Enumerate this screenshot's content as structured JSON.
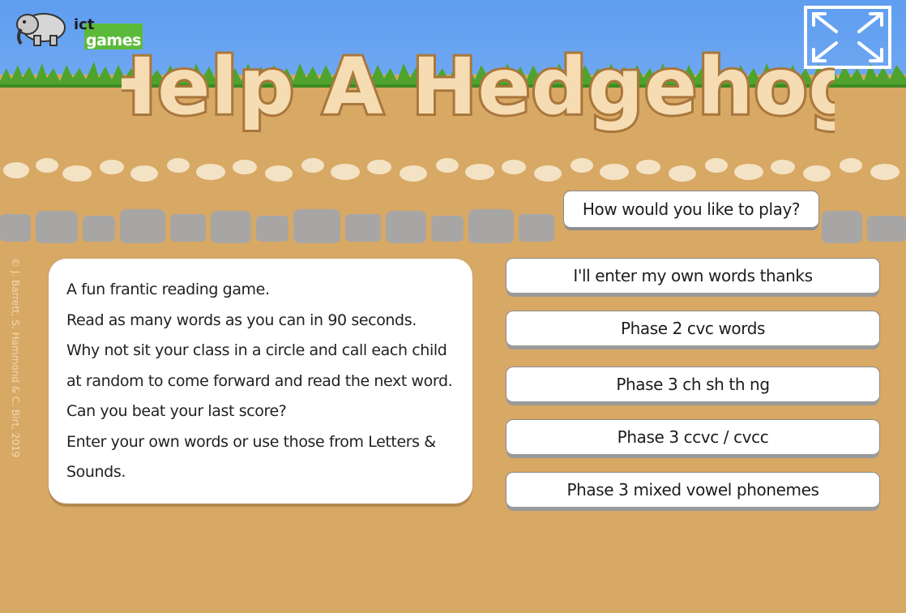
{
  "logo": {
    "prefix": "ict",
    "word": "games"
  },
  "title": "Help A Hedgehog",
  "copyright": "© J. Barrett, S. Hammond & C. Birt, 2019",
  "intro": {
    "lines": [
      "A fun frantic reading game.",
      "Read as many words as you can in 90 seconds.",
      "Why not sit your class in a circle and call each child",
      "at random to come forward and read the next word.",
      "Can you beat your last score?",
      "Enter your own words or use those from Letters &",
      "Sounds."
    ]
  },
  "menu": {
    "question": "How would you like to play?",
    "options": [
      "I'll enter my own words thanks",
      "Phase 2 cvc words",
      "Phase 3 ch sh th ng",
      "Phase 3 ccvc / cvcc",
      "Phase 3 mixed vowel phonemes"
    ]
  },
  "icons": {
    "logo": "elephant-icon",
    "fullscreen": "fullscreen-icon"
  },
  "colors": {
    "sky": "#5f9df0",
    "grass": "#4fa32d",
    "dirt": "#d8a865",
    "title_fill": "#f6dcb2",
    "title_outline": "#a9773c"
  }
}
